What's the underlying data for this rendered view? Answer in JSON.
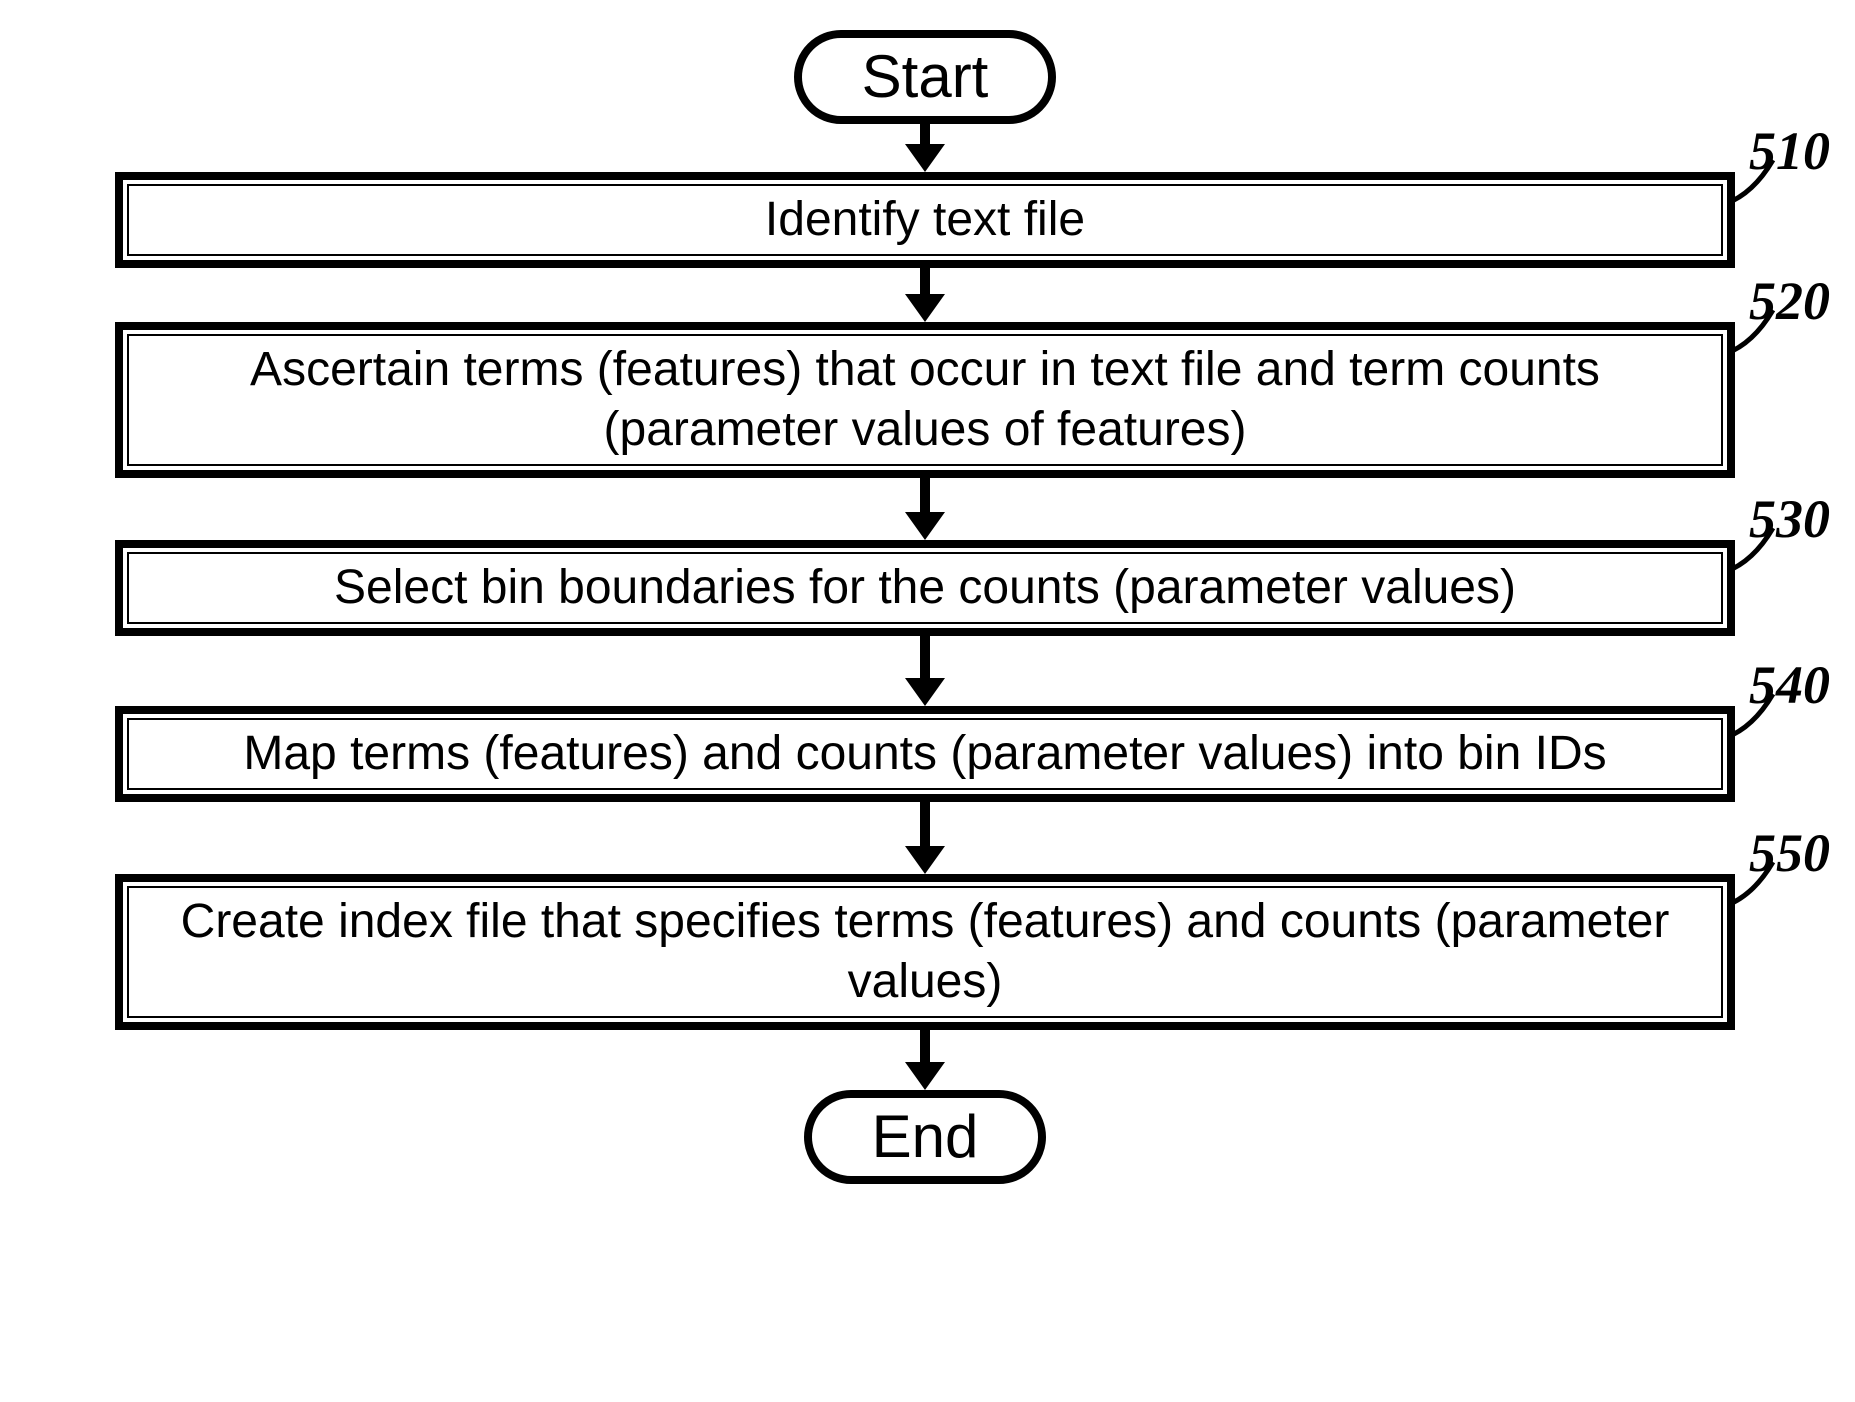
{
  "flowchart": {
    "start": "Start",
    "end": "End",
    "steps": [
      {
        "ref": "510",
        "text": "Identify text file"
      },
      {
        "ref": "520",
        "text": "Ascertain terms (features) that occur in text file and term counts (parameter values of features)"
      },
      {
        "ref": "530",
        "text": "Select bin boundaries for the counts (parameter values)"
      },
      {
        "ref": "540",
        "text": "Map terms (features) and counts (parameter values) into bin  IDs"
      },
      {
        "ref": "550",
        "text": "Create index file that specifies terms (features) and counts (parameter values)"
      }
    ]
  }
}
